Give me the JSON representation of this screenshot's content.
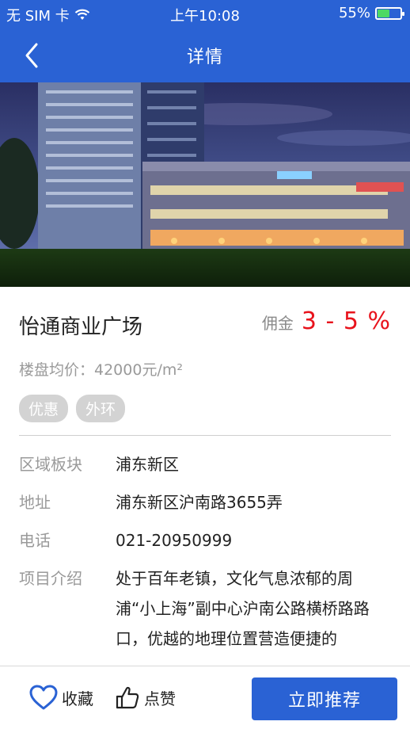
{
  "status_bar": {
    "carrier": "无 SIM 卡",
    "time": "上午10:08",
    "battery_percent": "55%",
    "battery_level": 0.55
  },
  "nav": {
    "title": "详情",
    "back_icon": "chevron-left-icon"
  },
  "project": {
    "name": "怡通商业广场",
    "commission_label": "佣金",
    "commission_value": "3 - 5 %",
    "price": "楼盘均价：42000元/m²",
    "tags": [
      "优惠",
      "外环"
    ]
  },
  "info": {
    "region_label": "区域板块",
    "region_value": "浦东新区",
    "address_label": "地址",
    "address_value": "浦东新区沪南路3655弄",
    "phone_label": "电话",
    "phone_value": "021-20950999",
    "intro_label": "项目介绍",
    "intro_value": "处于百年老镇，文化气息浓郁的周浦“小上海”副中心沪南公路横桥路路口，优越的地理位置营造便捷的"
  },
  "bottom_bar": {
    "favorite_label": "收藏",
    "like_label": "点赞",
    "recommend_label": "立即推荐"
  },
  "colors": {
    "primary": "#2a62d4",
    "commission": "#e8131c"
  }
}
